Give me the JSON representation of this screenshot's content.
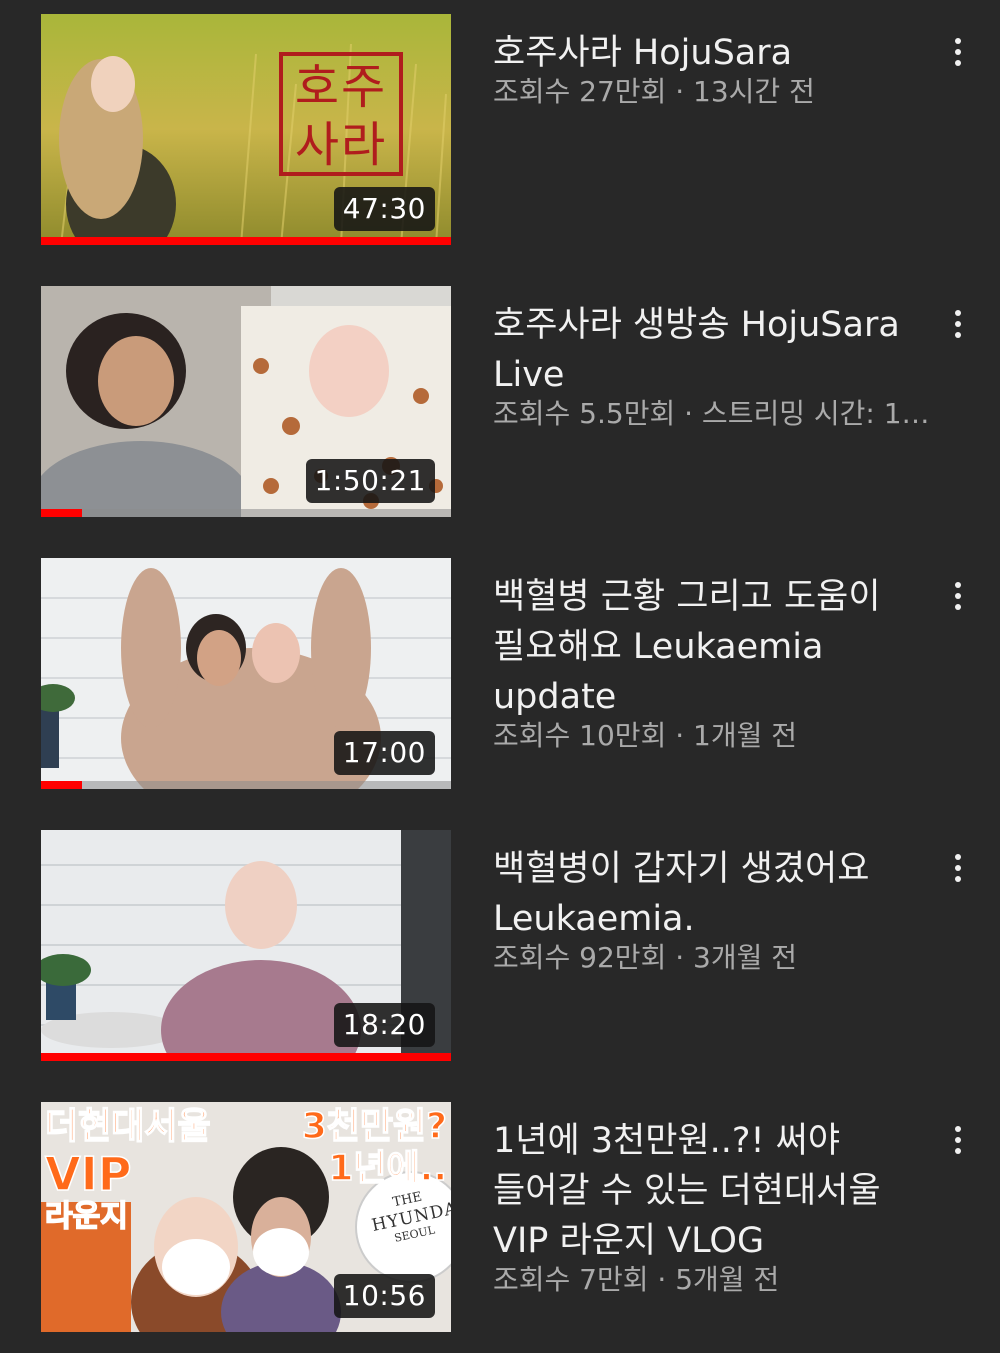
{
  "colors": {
    "background": "#282828",
    "title_text": "#f1f1f1",
    "meta_text": "#aaaaaa",
    "progress": "#ff0000"
  },
  "videos": [
    {
      "title": "호주사라 HojuSara",
      "meta": "조회수 27만회 · 13시간 전",
      "duration": "47:30",
      "watched_fraction": 1.0,
      "menu_icon": "more-vert-icon"
    },
    {
      "title": "호주사라 생방송 HojuSara Live",
      "meta": "조회수 5.5만회 · 스트리밍 시간: 1…",
      "duration": "1:50:21",
      "watched_fraction": 0.1,
      "menu_icon": "more-vert-icon"
    },
    {
      "title": "백혈병 근황 그리고 도움이 필요해요 Leukaemia update",
      "meta": "조회수 10만회 · 1개월 전",
      "duration": "17:00",
      "watched_fraction": 0.1,
      "menu_icon": "more-vert-icon"
    },
    {
      "title": "백혈병이 갑자기 생겼어요 Leukaemia.",
      "meta": "조회수 92만회 · 3개월 전",
      "duration": "18:20",
      "watched_fraction": 1.0,
      "menu_icon": "more-vert-icon"
    },
    {
      "title": "1년에 3천만원..?! 써야 들어갈 수 있는 더현대서울 VIP 라운지 VLOG",
      "meta": "조회수 7만회 · 5개월 전",
      "duration": "10:56",
      "watched_fraction": 0,
      "menu_icon": "more-vert-icon",
      "thumb_text": {
        "left_top": "더현대서울",
        "left_vip": "VIP",
        "left_lounge": "라운지",
        "right_top": "3천만원?",
        "right_sub": "1년에..",
        "sign_the": "THE",
        "sign_hyundai": "HYUNDAI",
        "sign_seoul": "SEOUL"
      }
    }
  ],
  "thumb1_seal": "호주사라"
}
